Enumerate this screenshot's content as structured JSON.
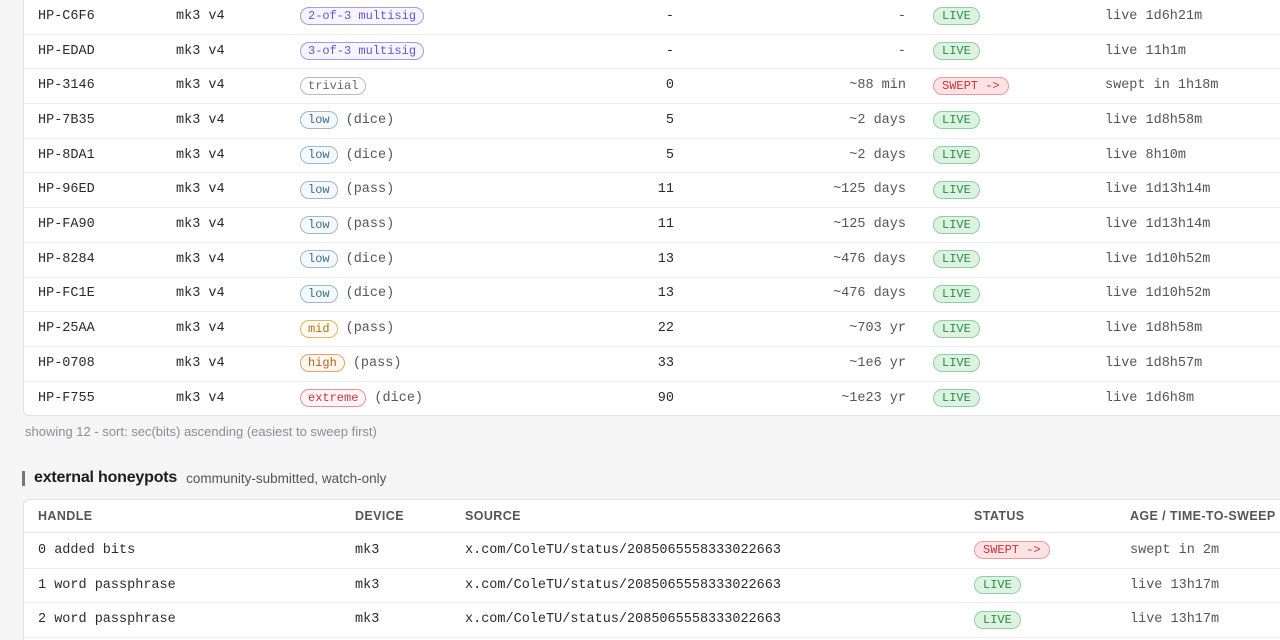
{
  "internal": {
    "rows": [
      {
        "handle": "HP-C6F6",
        "device": "mk3 v4",
        "sec_label": "2-of-3 multisig",
        "sec_class": "multisig",
        "sec_suffix": "",
        "bits": "-",
        "time": "-",
        "status": "LIVE",
        "status_class": "live",
        "age": "live 1d6h21m"
      },
      {
        "handle": "HP-EDAD",
        "device": "mk3 v4",
        "sec_label": "3-of-3 multisig",
        "sec_class": "multisig",
        "sec_suffix": "",
        "bits": "-",
        "time": "-",
        "status": "LIVE",
        "status_class": "live",
        "age": "live 11h1m"
      },
      {
        "handle": "HP-3146",
        "device": "mk3 v4",
        "sec_label": "trivial",
        "sec_class": "trivial",
        "sec_suffix": "",
        "bits": "0",
        "time": "~88 min",
        "status": "SWEPT ->",
        "status_class": "swept",
        "age": "swept in 1h18m"
      },
      {
        "handle": "HP-7B35",
        "device": "mk3 v4",
        "sec_label": "low",
        "sec_class": "low",
        "sec_suffix": "(dice)",
        "bits": "5",
        "time": "~2 days",
        "status": "LIVE",
        "status_class": "live",
        "age": "live 1d8h58m"
      },
      {
        "handle": "HP-8DA1",
        "device": "mk3 v4",
        "sec_label": "low",
        "sec_class": "low",
        "sec_suffix": "(dice)",
        "bits": "5",
        "time": "~2 days",
        "status": "LIVE",
        "status_class": "live",
        "age": "live 8h10m"
      },
      {
        "handle": "HP-96ED",
        "device": "mk3 v4",
        "sec_label": "low",
        "sec_class": "low",
        "sec_suffix": "(pass)",
        "bits": "11",
        "time": "~125 days",
        "status": "LIVE",
        "status_class": "live",
        "age": "live 1d13h14m"
      },
      {
        "handle": "HP-FA90",
        "device": "mk3 v4",
        "sec_label": "low",
        "sec_class": "low",
        "sec_suffix": "(pass)",
        "bits": "11",
        "time": "~125 days",
        "status": "LIVE",
        "status_class": "live",
        "age": "live 1d13h14m"
      },
      {
        "handle": "HP-8284",
        "device": "mk3 v4",
        "sec_label": "low",
        "sec_class": "low",
        "sec_suffix": "(dice)",
        "bits": "13",
        "time": "~476 days",
        "status": "LIVE",
        "status_class": "live",
        "age": "live 1d10h52m"
      },
      {
        "handle": "HP-FC1E",
        "device": "mk3 v4",
        "sec_label": "low",
        "sec_class": "low",
        "sec_suffix": "(dice)",
        "bits": "13",
        "time": "~476 days",
        "status": "LIVE",
        "status_class": "live",
        "age": "live 1d10h52m"
      },
      {
        "handle": "HP-25AA",
        "device": "mk3 v4",
        "sec_label": "mid",
        "sec_class": "mid",
        "sec_suffix": "(pass)",
        "bits": "22",
        "time": "~703 yr",
        "status": "LIVE",
        "status_class": "live",
        "age": "live 1d8h58m"
      },
      {
        "handle": "HP-0708",
        "device": "mk3 v4",
        "sec_label": "high",
        "sec_class": "high",
        "sec_suffix": "(pass)",
        "bits": "33",
        "time": "~1e6 yr",
        "status": "LIVE",
        "status_class": "live",
        "age": "live 1d8h57m"
      },
      {
        "handle": "HP-F755",
        "device": "mk3 v4",
        "sec_label": "extreme",
        "sec_class": "extreme",
        "sec_suffix": "(dice)",
        "bits": "90",
        "time": "~1e23 yr",
        "status": "LIVE",
        "status_class": "live",
        "age": "live 1d6h8m"
      }
    ],
    "sort_note": "showing 12 - sort: sec(bits) ascending (easiest to sweep first)"
  },
  "external": {
    "title": "external honeypots",
    "subtitle": "community-submitted, watch-only",
    "columns": {
      "handle": "HANDLE",
      "device": "DEVICE",
      "source": "SOURCE",
      "status": "STATUS",
      "age": "AGE / TIME-TO-SWEEP"
    },
    "rows": [
      {
        "handle": "0 added bits",
        "device": "mk3",
        "source": "x.com/ColeTU/status/2085065558333022663",
        "status": "SWEPT ->",
        "status_class": "swept",
        "age": "swept in 2m"
      },
      {
        "handle": "1 word passphrase",
        "device": "mk3",
        "source": "x.com/ColeTU/status/2085065558333022663",
        "status": "LIVE",
        "status_class": "live",
        "age": "live 13h17m"
      },
      {
        "handle": "2 word passphrase",
        "device": "mk3",
        "source": "x.com/ColeTU/status/2085065558333022663",
        "status": "LIVE",
        "status_class": "live",
        "age": "live 13h17m"
      }
    ]
  },
  "colors": {
    "live": "#2c8a46",
    "swept": "#c7333b",
    "multisig": "#6a54c8"
  }
}
